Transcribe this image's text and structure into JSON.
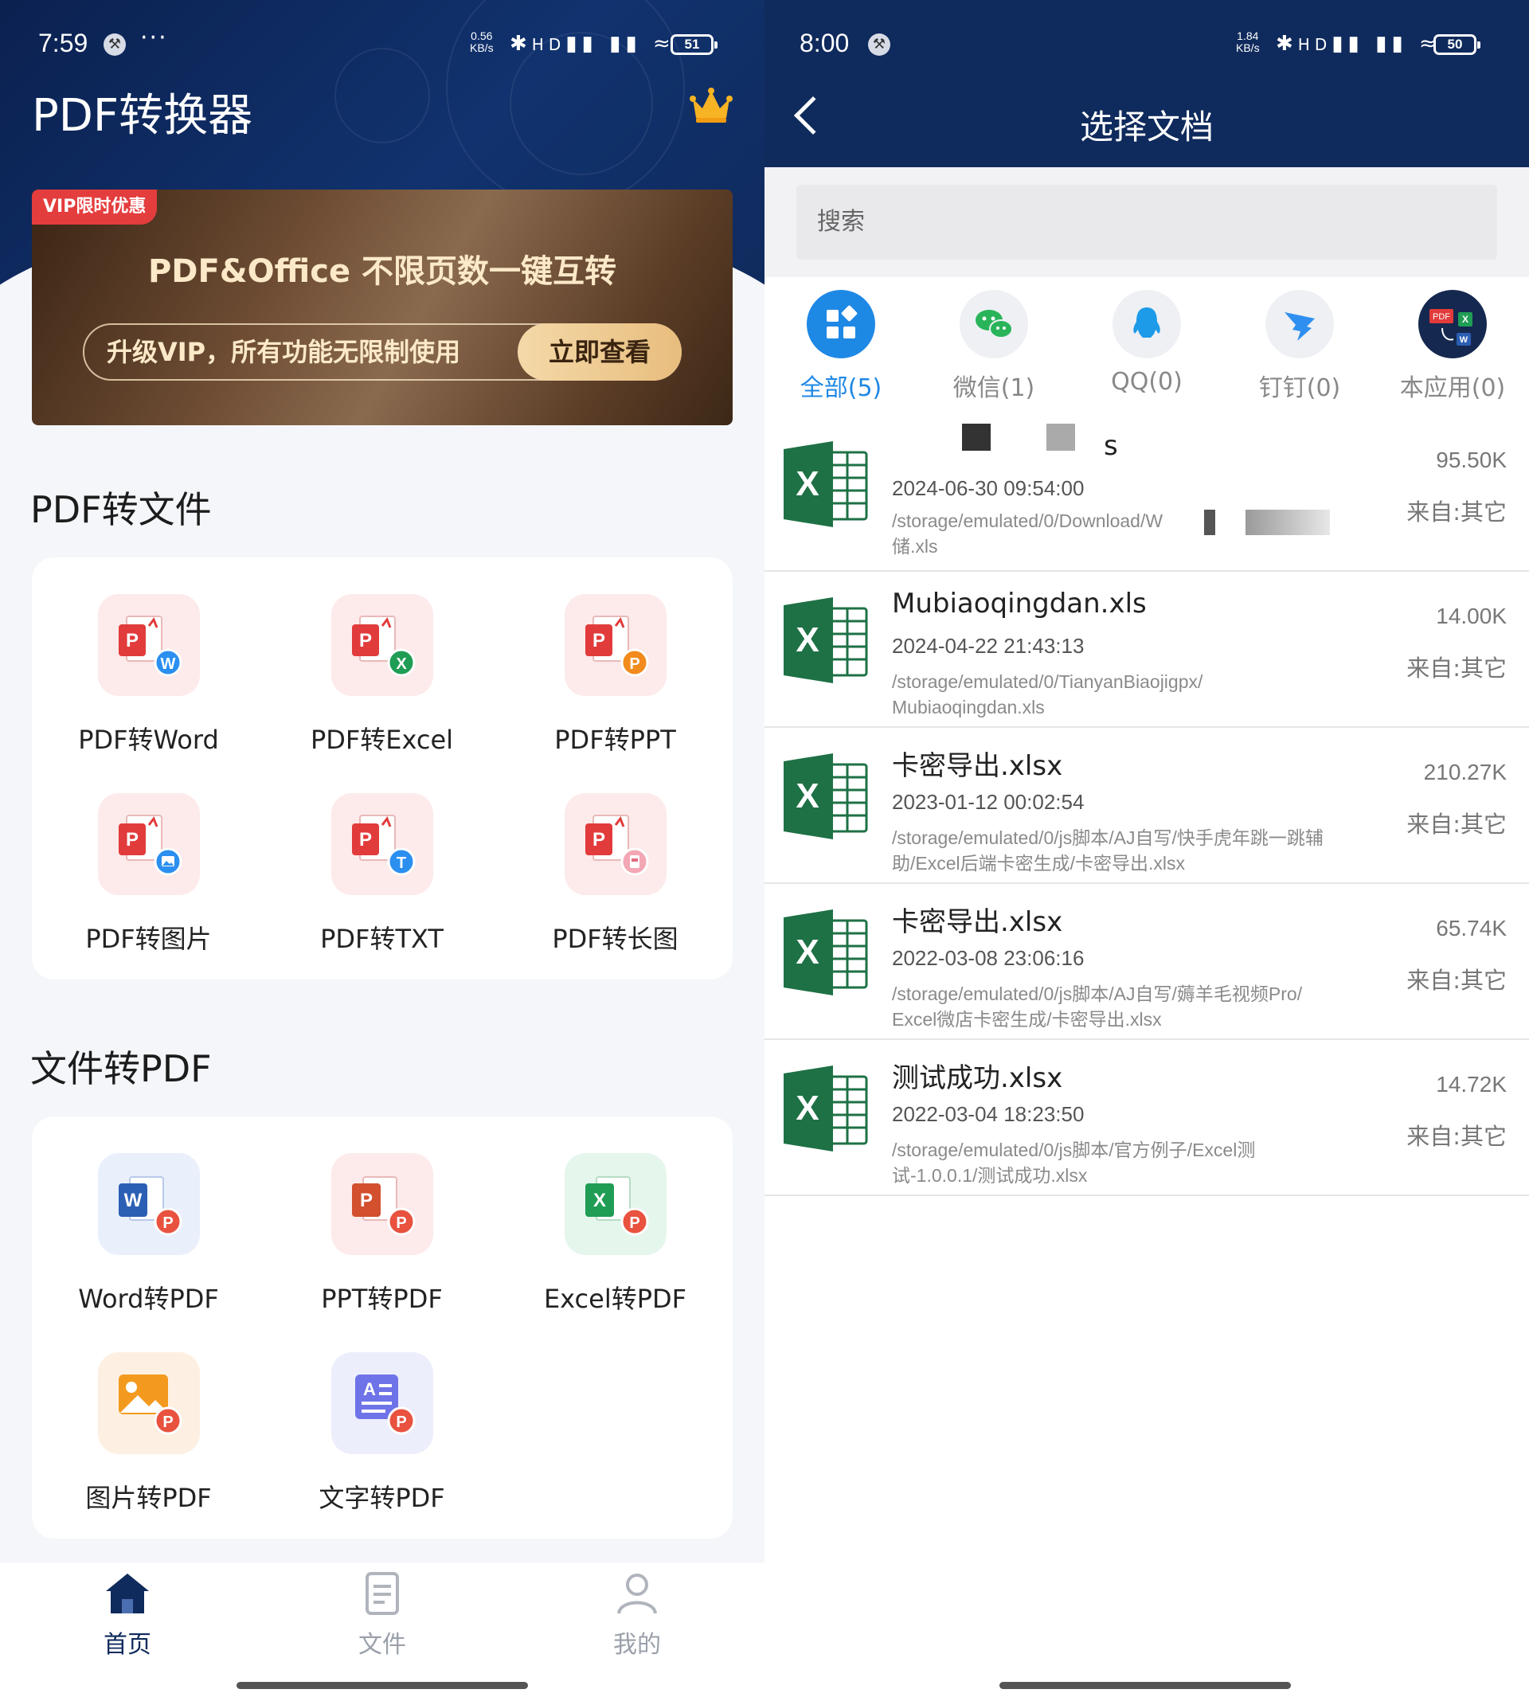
{
  "left": {
    "status": {
      "time": "7:59",
      "speed_value": "0.56",
      "speed_unit": "KB/s",
      "battery": "51"
    },
    "app_title": "PDF转换器",
    "banner": {
      "tag": "VIP限时优惠",
      "title": "PDF&Office 不限页数一键互转",
      "subtitle": "升级VIP，所有功能无限制使用",
      "button": "立即查看"
    },
    "section1": {
      "title": "PDF转文件",
      "tools": [
        {
          "label": "PDF转Word"
        },
        {
          "label": "PDF转Excel"
        },
        {
          "label": "PDF转PPT"
        },
        {
          "label": "PDF转图片"
        },
        {
          "label": "PDF转TXT"
        },
        {
          "label": "PDF转长图"
        }
      ]
    },
    "section2": {
      "title": "文件转PDF",
      "tools": [
        {
          "label": "Word转PDF"
        },
        {
          "label": "PPT转PDF"
        },
        {
          "label": "Excel转PDF"
        },
        {
          "label": "图片转PDF"
        },
        {
          "label": "文字转PDF"
        }
      ]
    },
    "nav": [
      {
        "label": "首页",
        "icon": "home-icon",
        "active": true
      },
      {
        "label": "文件",
        "icon": "file-icon",
        "active": false
      },
      {
        "label": "我的",
        "icon": "profile-icon",
        "active": false
      }
    ]
  },
  "right": {
    "status": {
      "time": "8:00",
      "speed_value": "1.84",
      "speed_unit": "KB/s",
      "battery": "50"
    },
    "title": "选择文档",
    "search_placeholder": "搜索",
    "sources": [
      {
        "label": "全部(5)",
        "icon": "grid-icon",
        "active": true
      },
      {
        "label": "微信(1)",
        "icon": "wechat-icon",
        "active": false
      },
      {
        "label": "QQ(0)",
        "icon": "qq-icon",
        "active": false
      },
      {
        "label": "钉钉(0)",
        "icon": "dingtalk-icon",
        "active": false
      },
      {
        "label": "本应用(0)",
        "icon": "this-app-icon",
        "active": false
      }
    ],
    "files": [
      {
        "name": "s",
        "date": "2024-06-30 09:54:00",
        "path": "/storage/emulated/0/Download/W",
        "path2": "储.xls",
        "size": "95.50K",
        "source": "来自:其它"
      },
      {
        "name": "Mubiaoqingdan.xls",
        "date": "2024-04-22 21:43:13",
        "path": "/storage/emulated/0/TianyanBiaojigpx/",
        "path2": "Mubiaoqingdan.xls",
        "size": "14.00K",
        "source": "来自:其它"
      },
      {
        "name": "卡密导出.xlsx",
        "date": "2023-01-12 00:02:54",
        "path": "/storage/emulated/0/js脚本/AJ自写/快手虎年跳一跳辅",
        "path2": "助/Excel后端卡密生成/卡密导出.xlsx",
        "size": "210.27K",
        "source": "来自:其它"
      },
      {
        "name": "卡密导出.xlsx",
        "date": "2022-03-08 23:06:16",
        "path": "/storage/emulated/0/js脚本/AJ自写/薅羊毛视频Pro/",
        "path2": "Excel微店卡密生成/卡密导出.xlsx",
        "size": "65.74K",
        "source": "来自:其它"
      },
      {
        "name": "测试成功.xlsx",
        "date": "2022-03-04 18:23:50",
        "path": "/storage/emulated/0/js脚本/官方例子/Excel测",
        "path2": "试-1.0.0.1/测试成功.xlsx",
        "size": "14.72K",
        "source": "来自:其它"
      }
    ]
  },
  "colors": {
    "header_navy": "#0f2a5c",
    "accent_blue": "#1e88e5",
    "excel_green": "#1e7145",
    "pdf_red": "#e23b3b",
    "vip_red": "#e43d3d",
    "gold": "#f4d9a8"
  }
}
